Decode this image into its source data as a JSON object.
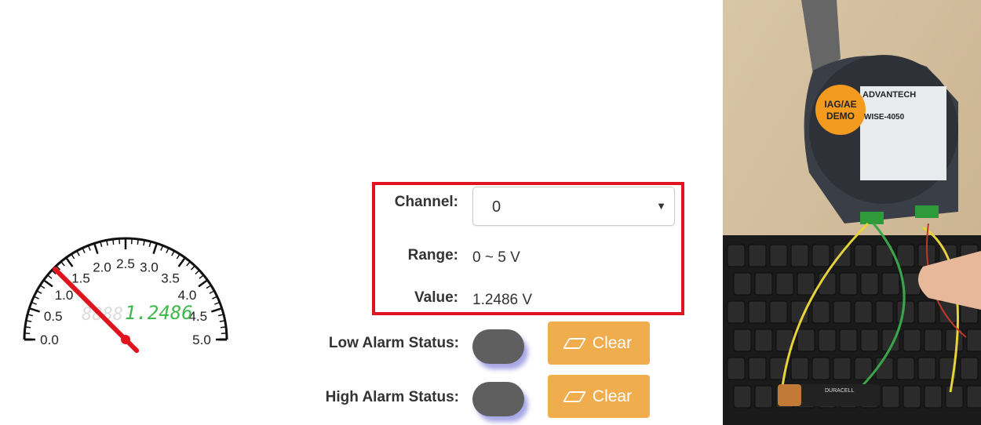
{
  "gauge": {
    "ticks": [
      "0.0",
      "0.5",
      "1.0",
      "1.5",
      "2.0",
      "2.5",
      "3.0",
      "3.5",
      "4.0",
      "4.5",
      "5.0"
    ],
    "min": 0,
    "max": 5,
    "value": 1.2486,
    "lcd_ghost": "8888",
    "lcd_value": "1.2486",
    "needle_color": "#e0141e",
    "lcd_color": "#3db84a"
  },
  "form": {
    "channel_label": "Channel:",
    "channel_value": "0",
    "range_label": "Range:",
    "range_value": "0 ~ 5 V",
    "value_label": "Value:",
    "value_value": "1.2486 V",
    "low_alarm_label": "Low Alarm Status:",
    "high_alarm_label": "High Alarm Status:",
    "clear_label": "Clear"
  },
  "photo": {
    "module_brand": "ADVANTECH",
    "module_model": "WISE-4050",
    "sticker_line1": "IAG/AE",
    "sticker_line2": "DEMO",
    "battery_brand": "DURACELL"
  },
  "colors": {
    "highlight": "#e0141e",
    "clear_button": "#f0ad4e",
    "led_off": "#5f5f5f"
  }
}
